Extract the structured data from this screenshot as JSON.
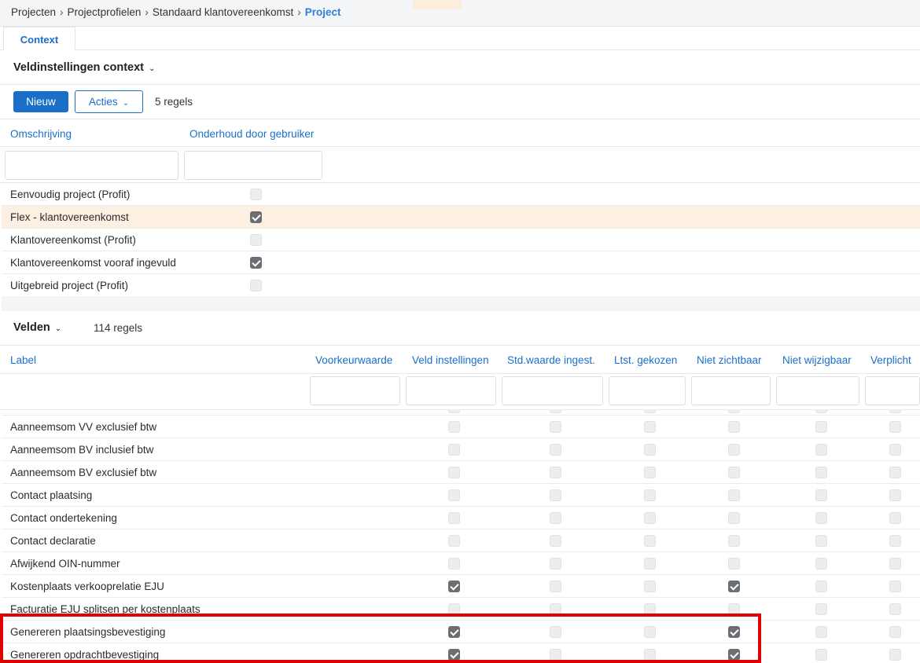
{
  "breadcrumb": {
    "items": [
      "Projecten",
      "Projectprofielen",
      "Standaard klantovereenkomst"
    ],
    "current": "Project",
    "separator": "›"
  },
  "tabs": [
    {
      "label": "Context",
      "active": true
    }
  ],
  "context_section": {
    "title": "Veldinstellingen context",
    "new_button": "Nieuw",
    "actions_button": "Acties",
    "row_count": "5 regels",
    "columns": [
      "Omschrijving",
      "Onderhoud door gebruiker"
    ],
    "rows": [
      {
        "label": "Eenvoudig project (Profit)",
        "checked": false,
        "highlighted": false
      },
      {
        "label": "Flex - klantovereenkomst",
        "checked": true,
        "highlighted": true
      },
      {
        "label": "Klantovereenkomst (Profit)",
        "checked": false,
        "highlighted": false
      },
      {
        "label": "Klantovereenkomst vooraf ingevuld",
        "checked": true,
        "highlighted": false
      },
      {
        "label": "Uitgebreid project (Profit)",
        "checked": false,
        "highlighted": false
      }
    ]
  },
  "fields_section": {
    "title": "Velden",
    "row_count": "114 regels",
    "columns": [
      "Label",
      "Voorkeurwaarde",
      "Veld instellingen",
      "Std.waarde ingest.",
      "Ltst. gekozen",
      "Niet zichtbaar",
      "Niet wijzigbaar",
      "Verplicht"
    ],
    "checkbox_columns": [
      "Veld instellingen",
      "Std.waarde ingest.",
      "Ltst. gekozen",
      "Niet zichtbaar",
      "Niet wijzigbaar",
      "Verplicht"
    ],
    "rows": [
      {
        "label": "Aanneemsom VV exclusief btw",
        "checks": [
          false,
          false,
          false,
          false,
          false,
          false
        ]
      },
      {
        "label": "Aanneemsom BV inclusief btw",
        "checks": [
          false,
          false,
          false,
          false,
          false,
          false
        ]
      },
      {
        "label": "Aanneemsom BV exclusief btw",
        "checks": [
          false,
          false,
          false,
          false,
          false,
          false
        ]
      },
      {
        "label": "Contact plaatsing",
        "checks": [
          false,
          false,
          false,
          false,
          false,
          false
        ]
      },
      {
        "label": "Contact ondertekening",
        "checks": [
          false,
          false,
          false,
          false,
          false,
          false
        ]
      },
      {
        "label": "Contact declaratie",
        "checks": [
          false,
          false,
          false,
          false,
          false,
          false
        ]
      },
      {
        "label": "Afwijkend OIN-nummer",
        "checks": [
          false,
          false,
          false,
          false,
          false,
          false
        ]
      },
      {
        "label": "Kostenplaats verkooprelatie EJU",
        "checks": [
          true,
          false,
          false,
          true,
          false,
          false
        ]
      },
      {
        "label": "Facturatie EJU splitsen per kostenplaats",
        "checks": [
          false,
          false,
          false,
          false,
          false,
          false
        ]
      },
      {
        "label": "Genereren plaatsingsbevestiging",
        "checks": [
          true,
          false,
          false,
          true,
          false,
          false
        ]
      },
      {
        "label": "Genereren opdrachtbevestiging",
        "checks": [
          true,
          false,
          false,
          true,
          false,
          false
        ]
      }
    ]
  },
  "colors": {
    "accent": "#1a6fc9",
    "highlight_row": "#fdf0e3",
    "annotation_box": "#e00000"
  }
}
